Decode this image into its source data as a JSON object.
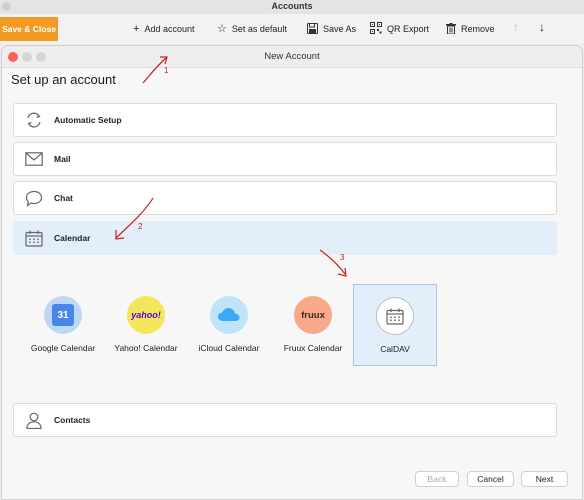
{
  "window": {
    "title": "Accounts"
  },
  "toolbar": {
    "save_close": "Save & Close",
    "add_account": "Add account",
    "set_default": "Set as default",
    "save_as": "Save As",
    "qr_export": "QR Export",
    "remove": "Remove",
    "move_up": "↑",
    "move_down": "↓"
  },
  "dialog": {
    "title": "New Account",
    "heading": "Set up an account",
    "rows": [
      {
        "label": "Automatic Setup",
        "icon": "refresh-icon"
      },
      {
        "label": "Mail",
        "icon": "envelope-icon"
      },
      {
        "label": "Chat",
        "icon": "chat-bubble-icon"
      },
      {
        "label": "Calendar",
        "icon": "calendar-icon"
      },
      {
        "label": "Contacts",
        "icon": "person-icon"
      }
    ],
    "providers": [
      {
        "label": "Google Calendar",
        "icon_text": "31"
      },
      {
        "label": "Yahoo! Calendar",
        "icon_text": "yahoo!"
      },
      {
        "label": "iCloud Calendar",
        "icon_text": ""
      },
      {
        "label": "Fruux Calendar",
        "icon_text": "fruux"
      },
      {
        "label": "CalDAV",
        "icon_text": ""
      }
    ],
    "buttons": {
      "back": "Back",
      "cancel": "Cancel",
      "next": "Next"
    }
  },
  "annotations": {
    "n1": "1",
    "n2": "2",
    "n3": "3"
  },
  "colors": {
    "save_close": "#f39a22",
    "selected": "#e3eefb",
    "annotation": "#c8201d",
    "google": "#4a86e8",
    "yahoo": "#6001d2",
    "icloud": "#3fa8f4",
    "fruux": "#f7a98a"
  }
}
